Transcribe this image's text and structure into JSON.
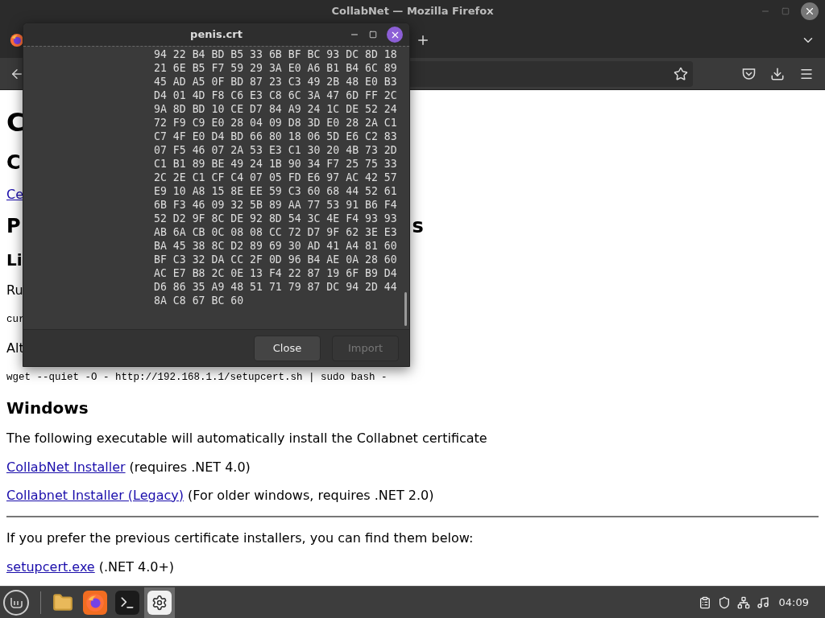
{
  "browser": {
    "title": "CollabNet — Mozilla Firefox"
  },
  "page": {
    "items": [
      {
        "kind": "h1",
        "text": "C"
      },
      {
        "kind": "h2",
        "text": "C"
      },
      {
        "kind": "link",
        "text": "Ce"
      },
      {
        "kind": "h2",
        "text": "P",
        "tail": "s"
      },
      {
        "kind": "h3",
        "text": "Li"
      },
      {
        "kind": "p",
        "text": "Ru"
      },
      {
        "kind": "code",
        "text": "cur"
      },
      {
        "kind": "p",
        "text": "Alt"
      },
      {
        "kind": "code",
        "text": "wget --quiet -O - http://192.168.1.1/setupcert.sh | sudo bash -"
      },
      {
        "kind": "h3",
        "text": "Windows"
      },
      {
        "kind": "p",
        "text": "The following executable will automatically install the Collabnet certificate"
      },
      {
        "kind": "link",
        "text": "CollabNet Installer",
        "note": "(requires .NET 4.0)"
      },
      {
        "kind": "link",
        "text": "Collabnet Installer (Legacy)",
        "note": "(For older windows, requires .NET 2.0)"
      },
      {
        "kind": "hr"
      },
      {
        "kind": "p",
        "text": "If you prefer the previous certificate installers, you can find them below:"
      },
      {
        "kind": "link",
        "text": "setupcert.exe",
        "note": "(.NET 4.0+)"
      }
    ]
  },
  "dialog": {
    "title": "penis.crt",
    "hex_rows": [
      "94 22 B4 BD B5 33 6B BF BC 93 DC 8D 18",
      "21 6E B5 F7 59 29 3A E0 A6 B1 B4 6C 89",
      "45 AD A5 0F BD 87 23 C3 49 2B 48 E0 B3",
      "D4 01 4D F8 C6 E3 C8 6C 3A 47 6D FF 2C",
      "9A 8D BD 10 CE D7 84 A9 24 1C DE 52 24",
      "72 F9 C9 E0 28 04 09 D8 3D E0 28 2A C1",
      "C7 4F E0 D4 BD 66 80 18 06 5D E6 C2 83",
      "07 F5 46 07 2A 53 E3 C1 30 20 4B 73 2D",
      "C1 B1 89 BE 49 24 1B 90 34 F7 25 75 33",
      "2C 2E C1 CF C4 07 05 FD E6 97 AC 42 57",
      "E9 10 A8 15 8E EE 59 C3 60 68 44 52 61",
      "6B F3 46 09 32 5B 89 AA 77 53 91 B6 F4",
      "52 D2 9F 8C DE 92 8D 54 3C 4E F4 93 93",
      "AB 6A CB 0C 08 08 CC 72 D7 9F 62 3E E3",
      "BA 45 38 8C D2 89 69 30 AD 41 A4 81 60",
      "BF C3 32 DA CC 2F 0D 96 B4 AE 0A 28 60",
      "AC E7 B8 2C 0E 13 F4 22 87 19 6F B9 D4",
      "D6 86 35 A9 48 51 71 79 87 DC 94 2D 44",
      "8A C8 67 BC 60"
    ],
    "buttons": [
      {
        "label": "Close",
        "disabled": false
      },
      {
        "label": "Import",
        "disabled": true
      }
    ]
  },
  "taskbar": {
    "apps": [
      {
        "kind": "files",
        "selected": false
      },
      {
        "kind": "firefox",
        "selected": false
      },
      {
        "kind": "terminal",
        "selected": false
      },
      {
        "kind": "settings",
        "selected": true
      }
    ],
    "clock": "04:09"
  }
}
